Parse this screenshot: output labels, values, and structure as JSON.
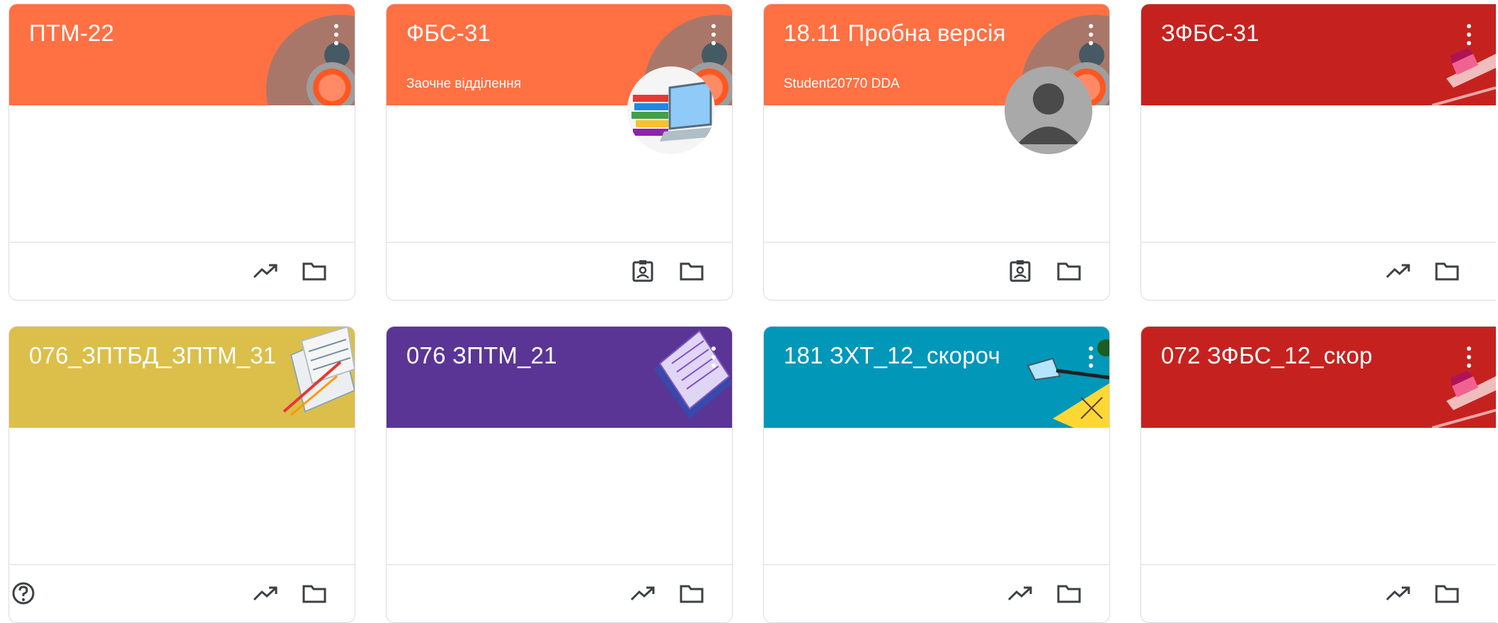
{
  "classes": [
    {
      "title": "ПТМ-22",
      "subtitle": "",
      "theme": "#ff7043"
    },
    {
      "title": "ФБС-31",
      "subtitle": "Заочне відділення",
      "theme": "#ff7043"
    },
    {
      "title": "18.11 Пробна версія",
      "subtitle": "Student20770 DDA",
      "theme": "#ff7043"
    },
    {
      "title": "ЗФБС-31",
      "subtitle": "",
      "theme": "#c5221f"
    },
    {
      "title": "076_ЗПТБД_ЗПТМ_31",
      "subtitle": "",
      "theme": "#dcbf4a"
    },
    {
      "title": "076 ЗПТМ_21",
      "subtitle": "",
      "theme": "#5a3595"
    },
    {
      "title": "181 ЗХТ_12_скороч",
      "subtitle": "",
      "theme": "#0097b9"
    },
    {
      "title": "072 ЗФБС_12_скор",
      "subtitle": "",
      "theme": "#c5221f"
    }
  ],
  "icons": {
    "more": "more-vert-icon",
    "trending": "trending-up-icon",
    "folder": "folder-icon",
    "assignment": "assignment-ind-icon",
    "help": "help-outline-icon",
    "avatar": "person-avatar-icon"
  }
}
